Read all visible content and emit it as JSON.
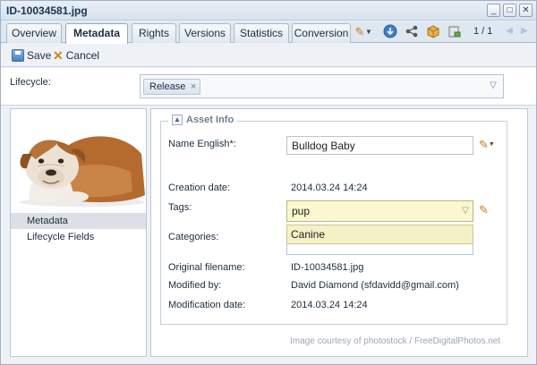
{
  "window": {
    "title": "ID-10034581.jpg",
    "controls": [
      "_",
      "□",
      "✕"
    ]
  },
  "tabs": [
    {
      "label": "Overview",
      "active": false
    },
    {
      "label": "Metadata",
      "active": true
    },
    {
      "label": "Rights",
      "active": false
    },
    {
      "label": "Versions",
      "active": false
    },
    {
      "label": "Statistics",
      "active": false
    },
    {
      "label": "Conversion",
      "active": false
    }
  ],
  "toolbar_icons": [
    "pencil-dropdown-icon",
    "download-icon",
    "share-icon",
    "package-icon",
    "edit-document-icon"
  ],
  "pager": {
    "text": "1 / 1"
  },
  "actions": {
    "save_label": "Save",
    "cancel_label": "Cancel"
  },
  "lifecycle": {
    "label": "Lifecycle:",
    "chip": "Release",
    "chip_remove": "×",
    "arrow": "▽"
  },
  "sidebar": {
    "items": [
      {
        "label": "Metadata",
        "selected": true
      },
      {
        "label": "Lifecycle Fields",
        "selected": false
      }
    ]
  },
  "asset_info": {
    "legend": "Asset Info",
    "collapse": "▲",
    "name_label": "Name English*:",
    "name_value": "Bulldog Baby",
    "creation_label": "Creation date:",
    "creation_value": "2014.03.24 14:24",
    "tags_label": "Tags:",
    "tags_value": "pup",
    "tags_arrow": "▽",
    "tags_suggestion": "Canine",
    "categories_label": "Categories:",
    "filename_label": "Original filename:",
    "filename_value": "ID-10034581.jpg",
    "modified_by_label": "Modified by:",
    "modified_by_value": "David Diamond (sfdavidd@gmail.com)",
    "modification_label": "Modification date:",
    "modification_value": "2014.03.24 14:24"
  },
  "caption": "Image courtesy of photostock / FreeDigitalPhotos.net",
  "colors": {
    "window_bg": "#eef2f7",
    "tab_active": "#ffffff",
    "tags_highlight": "#fbf8cf",
    "accent_orange": "#e07b1f"
  }
}
